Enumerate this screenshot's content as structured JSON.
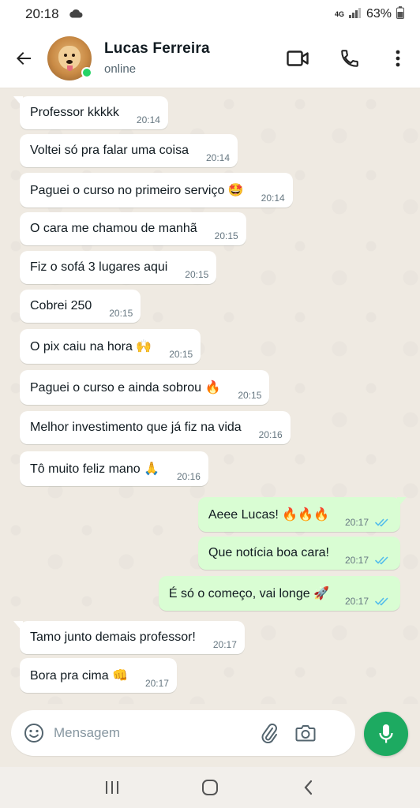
{
  "status_bar": {
    "time": "20:18",
    "network": "4G",
    "battery": "63%"
  },
  "header": {
    "contact_name": "Lucas Ferreira",
    "presence": "online"
  },
  "messages": [
    {
      "dir": "in",
      "text": "Professor kkkkk",
      "time": "20:14"
    },
    {
      "dir": "in",
      "text": "Voltei só pra falar uma coisa",
      "time": "20:14"
    },
    {
      "dir": "in",
      "text": "Paguei o curso no primeiro serviço 🤩",
      "time": "20:14"
    },
    {
      "dir": "in",
      "text": "O cara me chamou de manhã",
      "time": "20:15"
    },
    {
      "dir": "in",
      "text": "Fiz o sofá 3 lugares aqui",
      "time": "20:15"
    },
    {
      "dir": "in",
      "text": "Cobrei 250",
      "time": "20:15"
    },
    {
      "dir": "in",
      "text": "O pix caiu na hora 🙌",
      "time": "20:15"
    },
    {
      "dir": "in",
      "text": "Paguei o curso e ainda sobrou 🔥",
      "time": "20:15"
    },
    {
      "dir": "in",
      "text": "Melhor investimento que já fiz na vida",
      "time": "20:16"
    },
    {
      "dir": "in",
      "text": "Tô muito feliz mano 🙏",
      "time": "20:16"
    },
    {
      "dir": "out",
      "text": "Aeee Lucas! 🔥🔥🔥",
      "time": "20:17",
      "read": true
    },
    {
      "dir": "out",
      "text": "Que notícia boa cara!",
      "time": "20:17",
      "read": true
    },
    {
      "dir": "out",
      "text": "É só o começo, vai longe 🚀",
      "time": "20:17",
      "read": true
    },
    {
      "dir": "in",
      "text": "Tamo junto demais professor!",
      "time": "20:17"
    },
    {
      "dir": "in",
      "text": "Bora pra cima 👊",
      "time": "20:17"
    }
  ],
  "composer": {
    "placeholder": "Mensagem",
    "value": ""
  },
  "colors": {
    "incoming_bubble": "#ffffff",
    "outgoing_bubble": "#d9fdd3",
    "chat_background": "#efeae2",
    "accent_green": "#1daa61",
    "read_ticks": "#53bdeb"
  },
  "icons": [
    "back-arrow-icon",
    "video-call-icon",
    "phone-icon",
    "more-vert-icon",
    "emoji-icon",
    "attach-icon",
    "camera-icon",
    "mic-icon",
    "recents-icon",
    "home-icon",
    "nav-back-icon"
  ]
}
